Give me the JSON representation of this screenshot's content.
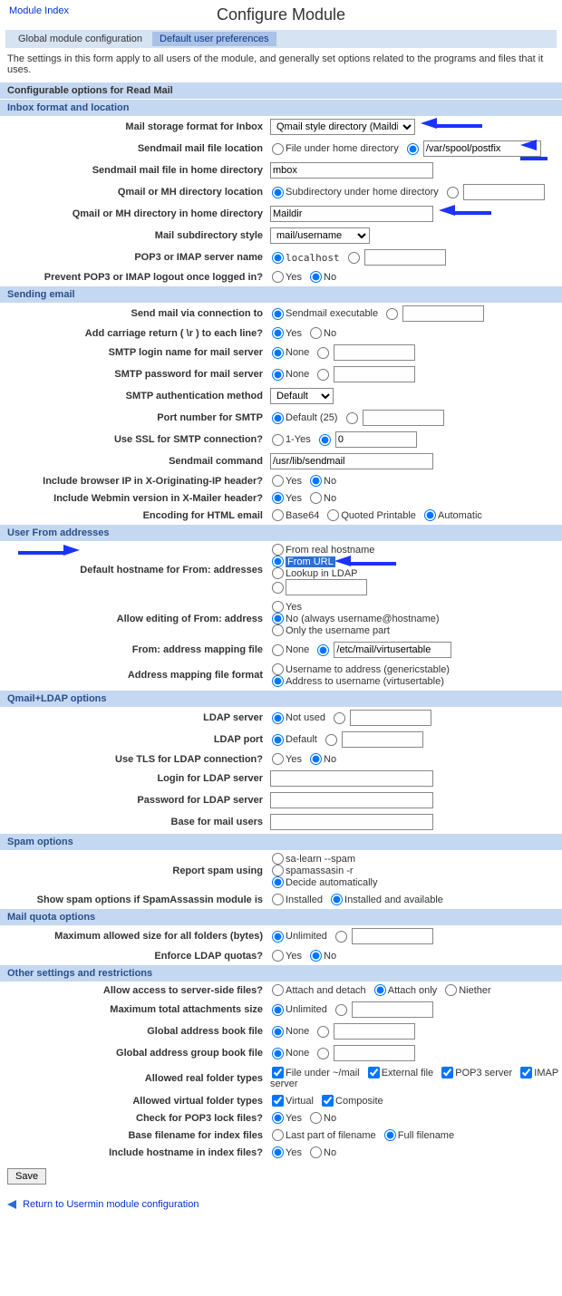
{
  "top_link": "Module Index",
  "title": "Configure Module",
  "tabs": {
    "active": "Global module configuration",
    "inactive": "Default user preferences"
  },
  "desc": "The settings in this form apply to all users of the module, and generally set options related to the programs and files that it uses.",
  "section_main": "Configurable options for Read Mail",
  "sub_inbox": "Inbox format and location",
  "inbox": {
    "storage_lbl": "Mail storage format for Inbox",
    "storage_sel": "Qmail style directory (Maildir)",
    "sendmail_loc_lbl": "Sendmail mail file location",
    "sendmail_loc_opt1": "File under home directory",
    "sendmail_loc_val": "/var/spool/postfix",
    "sendmail_home_lbl": "Sendmail mail file in home directory",
    "sendmail_home_val": "mbox",
    "qmail_dir_loc_lbl": "Qmail or MH directory location",
    "qmail_dir_loc_opt": "Subdirectory under home directory",
    "qmail_home_lbl": "Qmail or MH directory in home directory",
    "qmail_home_val": "Maildir",
    "subdirstyle_lbl": "Mail subdirectory style",
    "subdirstyle_sel": "mail/username",
    "pop3_lbl": "POP3 or IMAP server name",
    "pop3_opt": "localhost",
    "prevent_lbl": "Prevent POP3 or IMAP logout once logged in?",
    "yes": "Yes",
    "no": "No"
  },
  "sub_send": "Sending email",
  "send": {
    "via_lbl": "Send mail via connection to",
    "via_opt": "Sendmail executable",
    "cr_lbl": "Add carriage return ( \\r ) to each line?",
    "smtp_login_lbl": "SMTP login name for mail server",
    "smtp_pass_lbl": "SMTP password for mail server",
    "none": "None",
    "auth_lbl": "SMTP authentication method",
    "auth_sel": "Default",
    "port_lbl": "Port number for SMTP",
    "port_opt": "Default (25)",
    "ssl_lbl": "Use SSL for SMTP connection?",
    "ssl_opt": "1-Yes",
    "ssl_val": "0",
    "sendmail_cmd_lbl": "Sendmail command",
    "sendmail_cmd_val": "/usr/lib/sendmail",
    "xorig_lbl": "Include browser IP in X-Originating-IP header?",
    "xmailer_lbl": "Include Webmin version in X-Mailer header?",
    "enc_lbl": "Encoding for HTML email",
    "enc_opt1": "Base64",
    "enc_opt2": "Quoted Printable",
    "enc_opt3": "Automatic"
  },
  "sub_from": "User From addresses",
  "from": {
    "host_lbl": "Default hostname for From: addresses",
    "host_opt1": "From real hostname",
    "host_opt2": "From URL",
    "host_opt3": "Lookup in LDAP",
    "editfrom_lbl": "Allow editing of From: address",
    "editfrom_opt1": "Yes",
    "editfrom_opt2": "No (always username@hostname)",
    "editfrom_opt3": "Only the username part",
    "mapfile_lbl": "From: address mapping file",
    "mapfile_none": "None",
    "mapfile_val": "/etc/mail/virtusertable",
    "mapfmt_lbl": "Address mapping file format",
    "mapfmt_opt1": "Username to address (genericstable)",
    "mapfmt_opt2": "Address to username (virtusertable)"
  },
  "sub_ldap": "Qmail+LDAP options",
  "ldap": {
    "server_lbl": "LDAP server",
    "server_opt": "Not used",
    "port_lbl": "LDAP port",
    "port_opt": "Default",
    "tls_lbl": "Use TLS for LDAP connection?",
    "login_lbl": "Login for LDAP server",
    "pass_lbl": "Password for LDAP server",
    "base_lbl": "Base for mail users"
  },
  "sub_spam": "Spam options",
  "spam": {
    "report_lbl": "Report spam using",
    "report_opt1": "sa-learn --spam",
    "report_opt2": "spamassasin -r",
    "report_opt3": "Decide automatically",
    "show_lbl": "Show spam options if SpamAssassin module is",
    "show_opt1": "Installed",
    "show_opt2": "Installed and available"
  },
  "sub_quota": "Mail quota options",
  "quota": {
    "max_lbl": "Maximum allowed size for all folders (bytes)",
    "unlimited": "Unlimited",
    "enforce_lbl": "Enforce LDAP quotas?"
  },
  "sub_other": "Other settings and restrictions",
  "other": {
    "serverfiles_lbl": "Allow access to server-side files?",
    "serverfiles_opt1": "Attach and detach",
    "serverfiles_opt2": "Attach only",
    "serverfiles_opt3": "Niether",
    "maxattach_lbl": "Maximum total attachments size",
    "addrbook_lbl": "Global address book file",
    "addrgroup_lbl": "Global address group book file",
    "realfolder_lbl": "Allowed real folder types",
    "realfolder_opt1": "File under ~/mail",
    "realfolder_opt2": "External file",
    "realfolder_opt3": "POP3 server",
    "realfolder_opt4": "IMAP server",
    "virtfolder_lbl": "Allowed virtual folder types",
    "virtfolder_opt1": "Virtual",
    "virtfolder_opt2": "Composite",
    "lockcheck_lbl": "Check for POP3 lock files?",
    "baseidx_lbl": "Base filename for index files",
    "baseidx_opt1": "Last part of filename",
    "baseidx_opt2": "Full filename",
    "inclhost_lbl": "Include hostname in index files?"
  },
  "save": "Save",
  "back": "Return to Usermin module configuration"
}
